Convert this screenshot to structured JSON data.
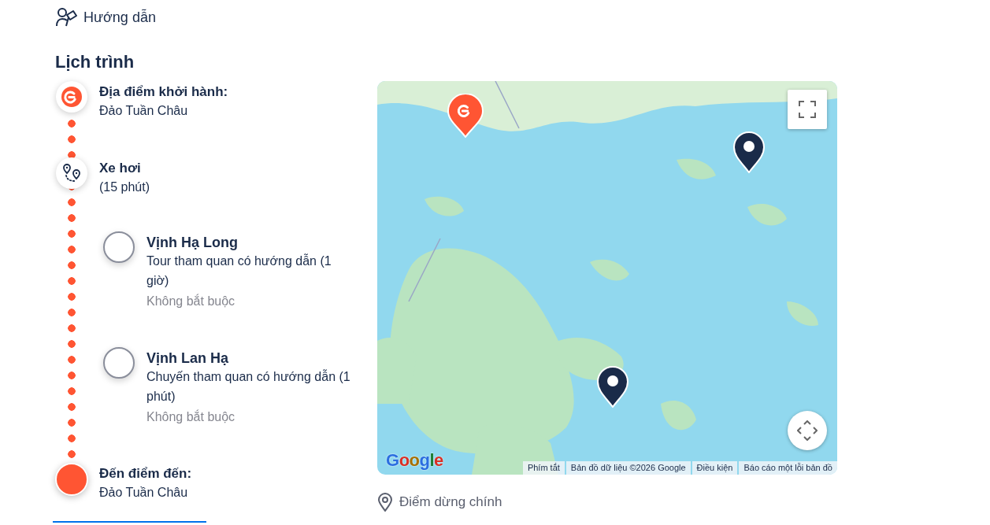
{
  "guide": {
    "label": "Hướng dẫn"
  },
  "itinerary": {
    "title": "Lịch trình",
    "steps": [
      {
        "kind": "start",
        "title": "Địa điểm khởi hành:",
        "detail": "Đảo Tuần Châu"
      },
      {
        "kind": "transport",
        "title": "Xe hơi",
        "detail": "(15 phút)"
      },
      {
        "kind": "stop",
        "title": "Vịnh Hạ Long",
        "detail": "Tour tham quan có hướng dẫn (1 giờ)",
        "note": "Không bắt buộc",
        "selected": false
      },
      {
        "kind": "stop",
        "title": "Vịnh Lan Hạ",
        "detail": "Chuyến tham quan có hướng dẫn (1 phút)",
        "note": "Không bắt buộc",
        "selected": false
      },
      {
        "kind": "end",
        "title": "Đến điểm đến:",
        "detail": "Đảo Tuần Châu"
      }
    ]
  },
  "map": {
    "markers": [
      {
        "kind": "brand"
      },
      {
        "kind": "plain"
      },
      {
        "kind": "plain"
      }
    ],
    "logo": "Google",
    "attribution": [
      "Phím tắt",
      "Bản đồ dữ liệu ©2026 Google",
      "Điều kiện",
      "Báo cáo một lỗi bản đồ"
    ]
  },
  "legend": {
    "label": "Điểm dừng chính"
  }
}
